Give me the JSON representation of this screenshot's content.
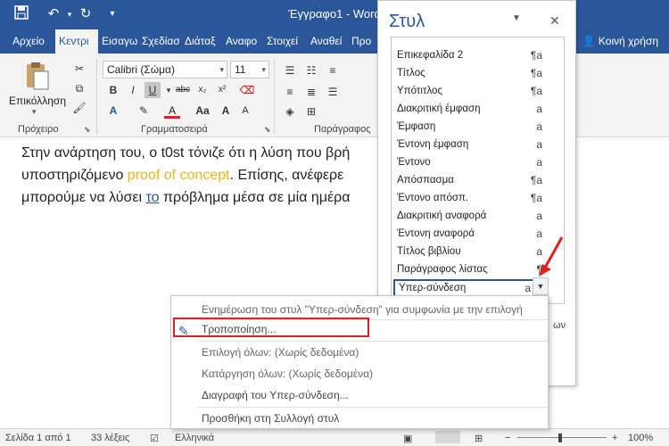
{
  "titlebar": {
    "title": "Έγγραφο1 - Word",
    "save_icon": "save-icon",
    "undo_icon": "undo-icon",
    "redo_icon": "redo-icon",
    "customize_icon": "customize-icon",
    "bg_color": "#2b579a"
  },
  "tabs": [
    "Αρχείο",
    "Κεντρι",
    "Εισαγω",
    "Σχεδίασ",
    "Διάταξ",
    "Αναφο",
    "Στοιχεί",
    "Αναθεί",
    "Προ"
  ],
  "share_label": "Κοινή χρήση",
  "ribbon": {
    "clipboard_label": "Πρόχειρο",
    "paste_label": "Επικόλληση",
    "font_label": "Γραμματοσειρά",
    "paragraph_label": "Παράγραφος",
    "font_name": "Calibri (Σώμα)",
    "font_size": "11"
  },
  "document": {
    "line1": "Στην ανάρτηση του, ο t0st τόνιζε ότι η λύση που βρή",
    "line2_a": "υποστηριζόμενο ",
    "line2_accent": "proof of concept",
    "line2_b": ". Επίσης, ανέφερε",
    "line3_a": "μπορούμε να λύσει ",
    "line3_underlined": "το",
    "line3_b": " πρόβλημα μέσα σε μία ημέρα"
  },
  "styles_pane": {
    "title": "Στυλ",
    "styles": [
      {
        "name": "Επικεφαλίδα 2",
        "mark": "¶a"
      },
      {
        "name": "Τίτλος",
        "mark": "¶a"
      },
      {
        "name": "Υπότιτλος",
        "mark": "¶a"
      },
      {
        "name": "Διακριτική έμφαση",
        "mark": "a"
      },
      {
        "name": "Έμφαση",
        "mark": "a"
      },
      {
        "name": "Έντονη έμφαση",
        "mark": "a"
      },
      {
        "name": "Έντονο",
        "mark": "a"
      },
      {
        "name": "Απόσπασμα",
        "mark": "¶a"
      },
      {
        "name": "Έντονο απόσπ.",
        "mark": "¶a"
      },
      {
        "name": "Διακριτική αναφορά",
        "mark": "a"
      },
      {
        "name": "Έντονη αναφορά",
        "mark": "a"
      },
      {
        "name": "Τίτλος βιβλίου",
        "mark": "a"
      },
      {
        "name": "Παράγραφος λίστας",
        "mark": "¶"
      },
      {
        "name": "Υπερ-σύνδεση",
        "mark": "a"
      }
    ],
    "bottom_text": "ων"
  },
  "context_menu": {
    "items": [
      "Ενημέρωση του στυλ \"Υπερ-σύνδεση\" για συμφωνία με την επιλογή",
      "Τροποποίηση...",
      "Επιλογή όλων: (Χωρίς δεδομένα)",
      "Κατάργηση όλων: (Χωρίς δεδομένα)",
      "Διαγραφή του Υπερ-σύνδεση...",
      "Προσθήκη στη Συλλογή στυλ"
    ]
  },
  "statusbar": {
    "page": "Σελίδα 1 από 1",
    "words": "33 λέξεις",
    "language": "Ελληνικά",
    "zoom": "100%"
  },
  "colors": {
    "accent": "#2b579a",
    "highlight_text": "#f0b31c",
    "annotation": "#e02020"
  }
}
